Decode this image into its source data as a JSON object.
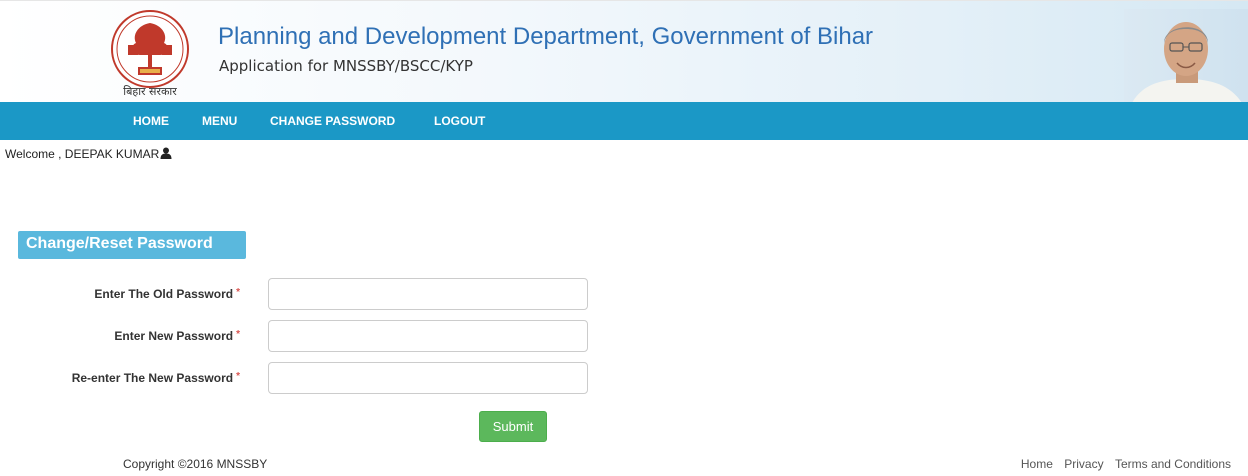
{
  "header": {
    "emblem_caption": "बिहार सरकार",
    "title": "Planning and Development Department, Government of Bihar",
    "subtitle": "Application for MNSSBY/BSCC/KYP"
  },
  "nav": {
    "items": [
      {
        "label": "HOME"
      },
      {
        "label": "MENU"
      },
      {
        "label": "CHANGE PASSWORD"
      },
      {
        "label": "LOGOUT"
      }
    ]
  },
  "welcome": {
    "text": "Welcome , DEEPAK KUMAR"
  },
  "form": {
    "title": "Change/Reset Password",
    "fields": [
      {
        "label": "Enter The Old Password",
        "required_marker": "*",
        "value": ""
      },
      {
        "label": "Enter New Password",
        "required_marker": "*",
        "value": ""
      },
      {
        "label": "Re-enter The New Password",
        "required_marker": "*",
        "value": ""
      }
    ],
    "submit_label": "Submit"
  },
  "footer": {
    "copyright": "Copyright ©2016 MNSSBY",
    "links": [
      {
        "label": "Home"
      },
      {
        "label": "Privacy"
      },
      {
        "label": "Terms and Conditions"
      }
    ]
  },
  "colors": {
    "navbar": "#1b98c6",
    "section_title_bg": "#5ab8dd",
    "title_blue": "#2f70b5",
    "submit_green": "#5cb85c",
    "required_red": "#d9534f"
  }
}
